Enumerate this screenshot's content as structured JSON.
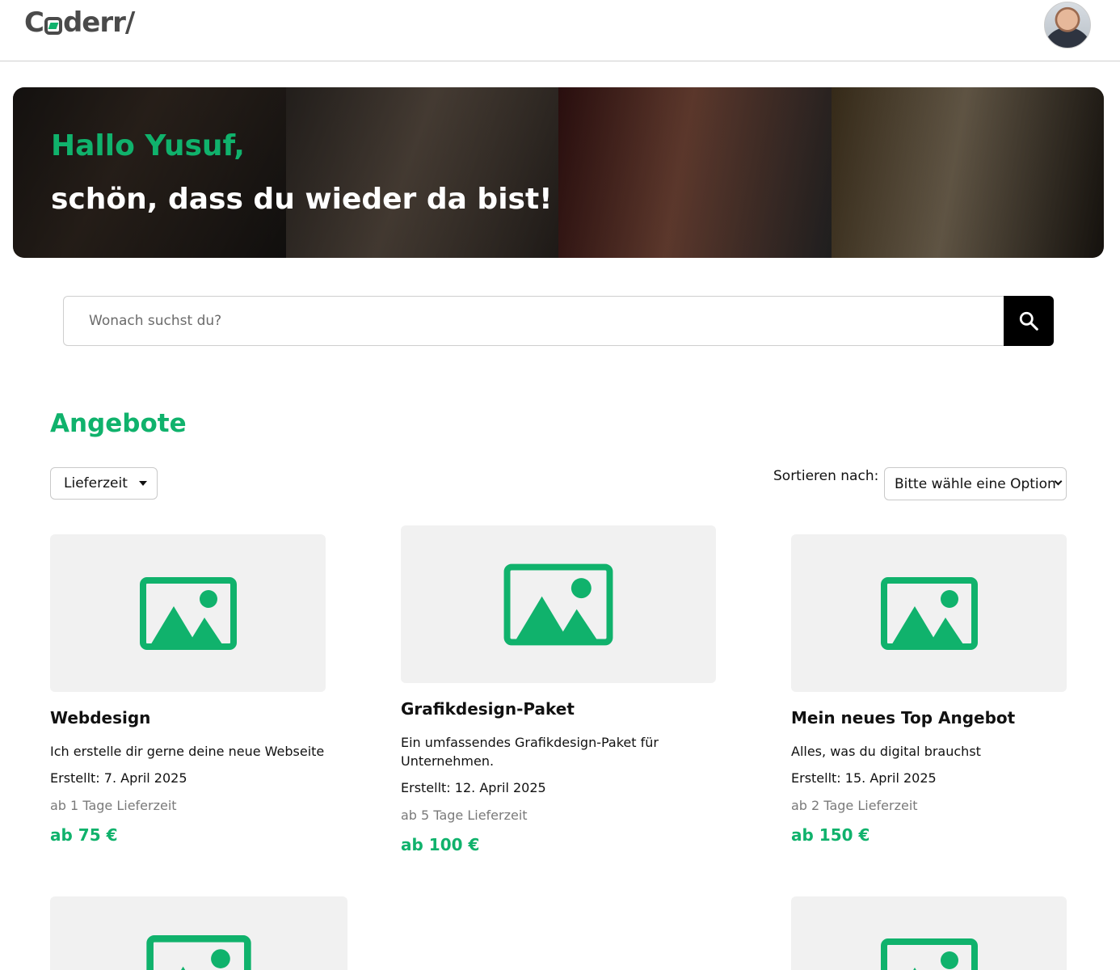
{
  "header": {
    "logo_text": "Coderr/",
    "logo_prefix": "C",
    "logo_suffix": "derr/",
    "avatar_alt": "Profilbild"
  },
  "hero": {
    "greeting": "Hallo Yusuf,",
    "welcome": "schön, dass du wieder da bist!"
  },
  "search": {
    "placeholder": "Wonach suchst du?",
    "button_icon": "search-icon"
  },
  "offers": {
    "title": "Angebote",
    "filter_label": "Lieferzeit",
    "sort_label": "Sortieren nach:",
    "sort_selected": "Bitte wähle eine Option",
    "cards": [
      {
        "title": "Webdesign",
        "description": "Ich erstelle dir gerne deine neue Webseite",
        "created": "Erstellt: 7. April 2025",
        "delivery": "ab 1 Tage Lieferzeit",
        "price": "ab 75 €"
      },
      {
        "title": "Grafikdesign-Paket",
        "description": "Ein umfassendes Grafikdesign-Paket für Unternehmen.",
        "created": "Erstellt: 12. April 2025",
        "delivery": "ab 5 Tage Lieferzeit",
        "price": "ab 100 €"
      },
      {
        "title": "Mein neues Top Angebot",
        "description": "Alles, was du digital brauchst",
        "created": "Erstellt: 15. April 2025",
        "delivery": "ab 2 Tage Lieferzeit",
        "price": "ab 150 €"
      }
    ]
  },
  "colors": {
    "accent": "#10b26c",
    "text": "#111111",
    "muted": "#7a7a7a",
    "thumb_bg": "#f1f1f1"
  }
}
